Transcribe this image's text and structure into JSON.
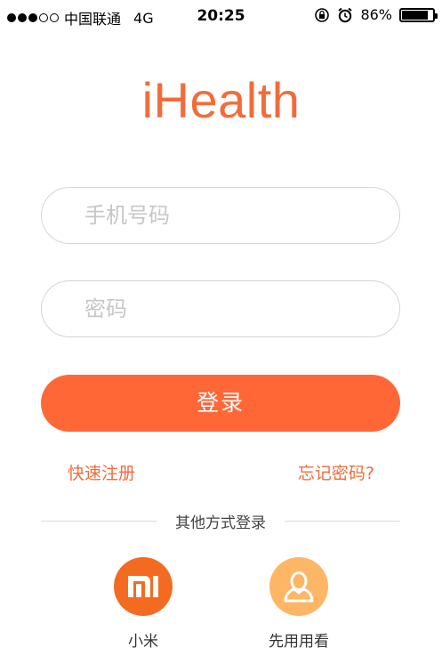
{
  "status_bar": {
    "signal_dots_filled": 3,
    "signal_dots_total": 5,
    "carrier": "中国联通",
    "network": "4G",
    "time": "20:25",
    "battery_percent": "86%",
    "battery_level": 0.86,
    "icons": [
      "orientation-lock-icon",
      "alarm-icon",
      "battery-icon"
    ]
  },
  "logo": {
    "text": "iHealth",
    "color": "#F26C3B"
  },
  "form": {
    "phone_placeholder": "手机号码",
    "password_placeholder": "密码",
    "login_label": "登录",
    "register_label": "快速注册",
    "forgot_label": "忘记密码?"
  },
  "other_login": {
    "title": "其他方式登录",
    "options": [
      {
        "label": "小米",
        "icon": "mi-logo-icon",
        "color": "#F36B21"
      },
      {
        "label": "先用用看",
        "icon": "user-avatar-icon",
        "color": "#FDB665"
      }
    ]
  },
  "colors": {
    "accent": "#FF6737"
  }
}
